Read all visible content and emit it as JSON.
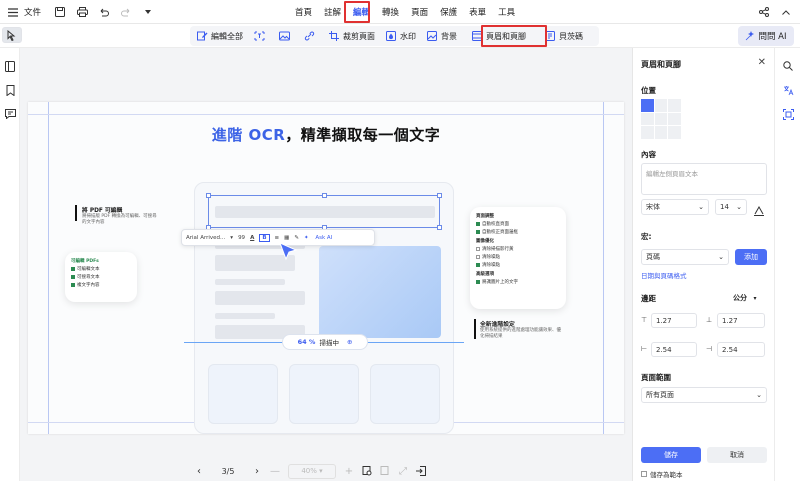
{
  "topbar": {
    "file_label": "文件",
    "menu": [
      "首頁",
      "註解",
      "編輯",
      "轉換",
      "頁面",
      "保護",
      "表單",
      "工具"
    ],
    "active_menu": "編輯"
  },
  "toolbar": {
    "edit_all": "編輯全部",
    "crop": "裁剪頁面",
    "watermark": "水印",
    "background": "背景",
    "header_footer": "頁眉和頁腳",
    "bates": "貝茨碼",
    "ask_ai": "問問 AI"
  },
  "page": {
    "headline_blue": "進階 OCR",
    "headline_rest": "，精準擷取每一個文字",
    "left_title": "將 PDF 可編輯",
    "left_sub1": "將掃描版 PDF 轉換為可編輯、可搜尋",
    "left_sub2": "的文字內容",
    "left_card_title": "可編輯 PDFs",
    "left_card_items": [
      "可編輯文本",
      "可搜尋文本",
      "複文字內容"
    ],
    "right_card_sec1": "頁面調整",
    "right_card_items1": [
      "自動校直頁面",
      "自動校正頁面邊框"
    ],
    "right_card_sec2": "圖像優化",
    "right_card_items2": [
      "清除掃描影行黃",
      "清除噪點",
      "清除噪點"
    ],
    "right_card_sec3": "高級選項",
    "right_card_items3": [
      "將識圖片上的文字"
    ],
    "right_title": "全新進階設定",
    "right_sub1": "使用系統提供的進階處理功能讓效果、優",
    "right_sub2": "化掃描結果",
    "float_font": "Arial Arrived...",
    "float_size": "99",
    "float_ask": "Ask AI",
    "progress_pct": "64 %",
    "progress_label": "掃描中"
  },
  "bottomnav": {
    "page_indicator": "3/5",
    "zoom": "40%"
  },
  "panel": {
    "title": "頁眉和頁腳",
    "position_label": "位置",
    "content_label": "內容",
    "content_placeholder": "編輯左側頁眉文本",
    "font": "宋体",
    "font_size": "14",
    "macro_label": "宏:",
    "macro_value": "頁碼",
    "add_btn": "添加",
    "date_format_link": "日期與頁碼格式",
    "margin_label": "邊距",
    "unit": "公分",
    "margin_top": "1.27",
    "margin_bottom": "1.27",
    "margin_left": "2.54",
    "margin_right": "2.54",
    "range_label": "頁面範圍",
    "range_value": "所有頁面",
    "save_btn": "儲存",
    "cancel_btn": "取消",
    "save_template": "儲存為範本"
  }
}
